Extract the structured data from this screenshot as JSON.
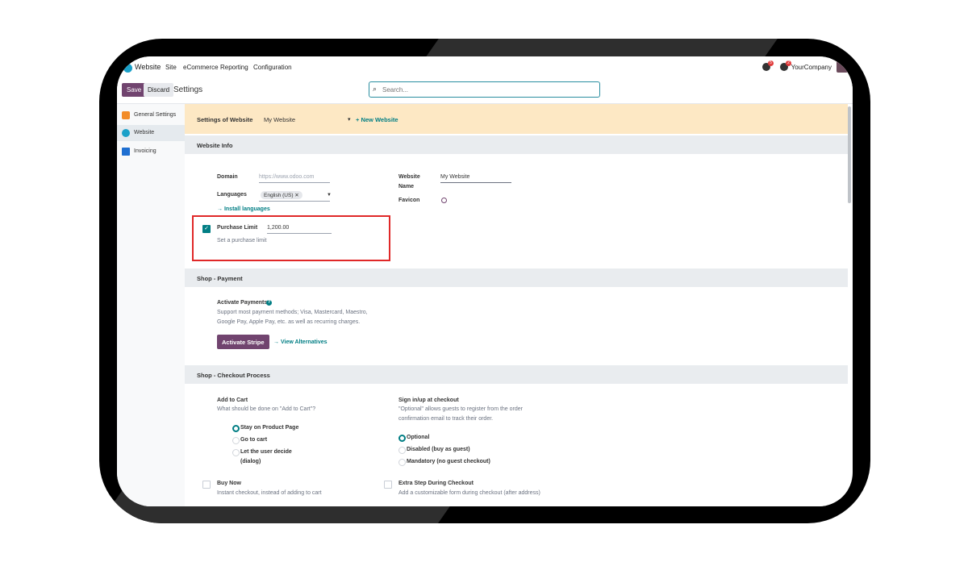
{
  "topnav": {
    "app": "Website",
    "items": [
      "Site",
      "eCommerce",
      "Reporting",
      "Configuration"
    ],
    "messages_badge": "5",
    "activity_badge": "2",
    "company": "YourCompany"
  },
  "control": {
    "save": "Save",
    "discard": "Discard",
    "breadcrumb": "Settings",
    "search_placeholder": "Search..."
  },
  "sidebar": {
    "items": [
      {
        "label": "General Settings",
        "icon": "settings-app-icon",
        "color": "#f28c28"
      },
      {
        "label": "Website",
        "icon": "website-app-icon",
        "color": "#1aa0c8",
        "active": true
      },
      {
        "label": "Invoicing",
        "icon": "invoicing-app-icon",
        "color": "#1f6fd1"
      }
    ]
  },
  "website_bar": {
    "label": "Settings of Website",
    "value": "My Website",
    "new_website": "+ New Website"
  },
  "website_info": {
    "title": "Website Info",
    "domain_label": "Domain",
    "domain_placeholder": "https://www.odoo.com",
    "languages_label": "Languages",
    "language_tag": "English (US)",
    "install_languages": "Install languages",
    "purchase_limit_label": "Purchase Limit",
    "purchase_limit_value": "1,200.00",
    "purchase_limit_help": "Set a purchase limit",
    "purchase_limit_checked": true,
    "website_name_label_1": "Website",
    "website_name_label_2": "Name",
    "website_name_value": "My Website",
    "favicon_label": "Favicon"
  },
  "shop_payment": {
    "title": "Shop - Payment",
    "activate_label": "Activate Payments",
    "desc_line1": "Support most payment methods; Visa, Mastercard, Maestro,",
    "desc_line2": "Google Pay, Apple Pay, etc. as well as recurring charges.",
    "activate_stripe": "Activate Stripe",
    "view_alternatives": "View Alternatives"
  },
  "checkout": {
    "title": "Shop - Checkout Process",
    "add_to_cart_label": "Add to Cart",
    "add_to_cart_desc": "What should be done on \"Add to Cart\"?",
    "cart_options": [
      "Stay on Product Page",
      "Go to cart",
      "Let the user decide",
      "(dialog)"
    ],
    "cart_selected": 0,
    "sign_label": "Sign in/up at checkout",
    "sign_desc_line1": "\"Optional\" allows guests to register from the order",
    "sign_desc_line2": "confirmation email to track their order.",
    "sign_options": [
      "Optional",
      "Disabled (buy as guest)",
      "Mandatory (no guest checkout)"
    ],
    "sign_selected": 0,
    "buy_now_label": "Buy Now",
    "buy_now_desc": "Instant checkout, instead of adding to cart",
    "extra_step_label": "Extra Step During Checkout",
    "extra_step_desc": "Add a customizable form during checkout (after address)"
  }
}
